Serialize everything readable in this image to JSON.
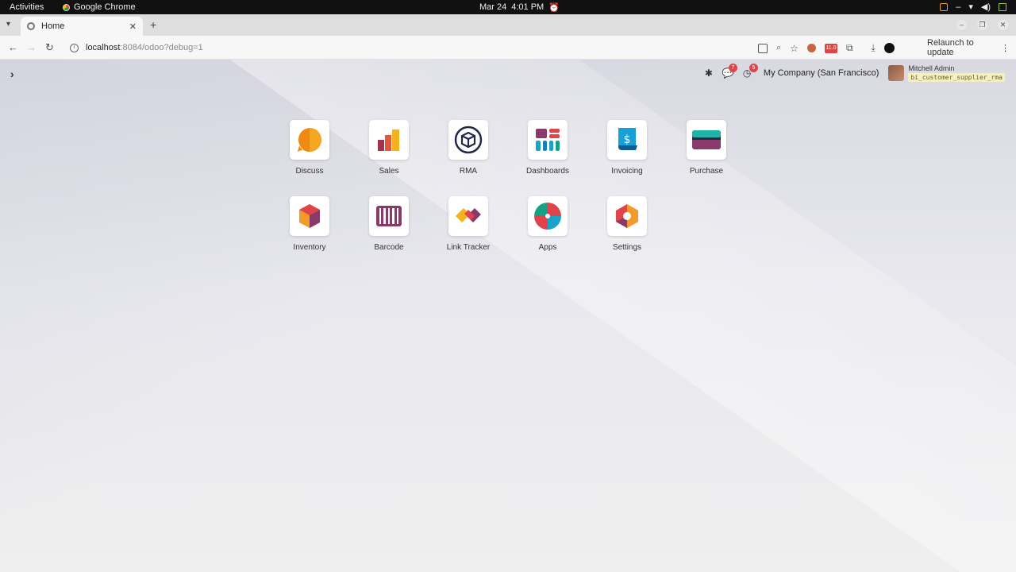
{
  "os": {
    "activities": "Activities",
    "app_name": "Google Chrome",
    "date": "Mar 24",
    "time": "4:01 PM"
  },
  "browser": {
    "tab_title": "Home",
    "url_host": "localhost",
    "url_rest": ":8084/odoo?debug=1",
    "relaunch_label": "Relaunch to update",
    "extension_badge": "11.0"
  },
  "odoo": {
    "company": "My Company (San Francisco)",
    "user_name": "Mitchell Admin",
    "database": "bi_customer_supplier_rma",
    "messages_count": "7",
    "activities_count": "5"
  },
  "apps": [
    {
      "label": "Discuss",
      "icon": "discuss-icon"
    },
    {
      "label": "Sales",
      "icon": "sales-icon"
    },
    {
      "label": "RMA",
      "icon": "rma-icon"
    },
    {
      "label": "Dashboards",
      "icon": "dashboards-icon"
    },
    {
      "label": "Invoicing",
      "icon": "invoicing-icon"
    },
    {
      "label": "Purchase",
      "icon": "purchase-icon"
    },
    {
      "label": "Inventory",
      "icon": "inventory-icon"
    },
    {
      "label": "Barcode",
      "icon": "barcode-icon"
    },
    {
      "label": "Link Tracker",
      "icon": "link-tracker-icon"
    },
    {
      "label": "Apps",
      "icon": "apps-icon"
    },
    {
      "label": "Settings",
      "icon": "settings-icon"
    }
  ]
}
